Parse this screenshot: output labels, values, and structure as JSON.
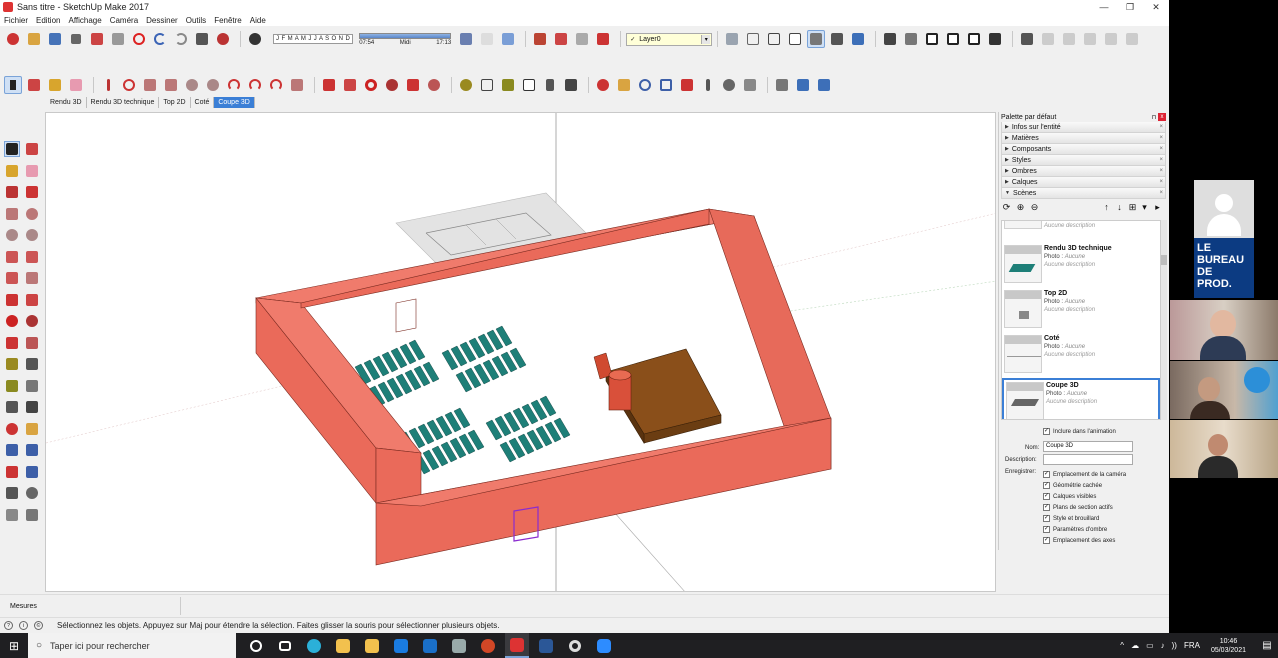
{
  "window": {
    "title": "Sans titre - SketchUp Make 2017",
    "controls": {
      "minimize": "—",
      "maximize": "❐",
      "close": "✕"
    }
  },
  "menu": [
    "Fichier",
    "Edition",
    "Affichage",
    "Caméra",
    "Dessiner",
    "Outils",
    "Fenêtre",
    "Aide"
  ],
  "shadows": {
    "months": "J F M A M J J A S O N D",
    "time_start": "07:54",
    "time_mid": "Midi",
    "time_end": "17:13"
  },
  "layer": {
    "current": "Layer0",
    "arrow": "▾",
    "check": "✓"
  },
  "scene_tabs": [
    {
      "label": "Rendu 3D",
      "active": false
    },
    {
      "label": "Rendu 3D technique",
      "active": false
    },
    {
      "label": "Top 2D",
      "active": false
    },
    {
      "label": "Coté",
      "active": false
    },
    {
      "label": "Coupe 3D",
      "active": true
    }
  ],
  "tray": {
    "title": "Palette par défaut",
    "pin": "⊓",
    "close": "x",
    "panels": [
      {
        "label": "Infos sur l'entité",
        "open": false
      },
      {
        "label": "Matières",
        "open": false
      },
      {
        "label": "Composants",
        "open": false
      },
      {
        "label": "Styles",
        "open": false
      },
      {
        "label": "Ombres",
        "open": false
      },
      {
        "label": "Calques",
        "open": false
      },
      {
        "label": "Scènes",
        "open": true
      }
    ],
    "tri_closed": "▶",
    "tri_open": "▼",
    "panel_x": "×"
  },
  "scenes": {
    "tools": [
      "⟳",
      "⊕",
      "⊖"
    ],
    "view_tools": [
      "↑",
      "↓",
      "⊞",
      "▾",
      "▸"
    ],
    "list": [
      {
        "name": "",
        "photo_label": "",
        "photo_value": "",
        "desc": "Aucune description",
        "selected": false
      },
      {
        "name": "Rendu 3D technique",
        "photo_label": "Photo : ",
        "photo_value": "Aucune",
        "desc": "Aucune description",
        "selected": false
      },
      {
        "name": "Top 2D",
        "photo_label": "Photo : ",
        "photo_value": "Aucune",
        "desc": "Aucune description",
        "selected": false
      },
      {
        "name": "Coté",
        "photo_label": "Photo : ",
        "photo_value": "Aucune",
        "desc": "Aucune description",
        "selected": false
      },
      {
        "name": "Coupe 3D",
        "photo_label": "Photo : ",
        "photo_value": "Aucune",
        "desc": "Aucune description",
        "selected": true
      }
    ],
    "include_animation": "Inclure dans l'animation",
    "name_label": "Nom:",
    "name_value": "Coupe 3D",
    "desc_label": "Description:",
    "save_label": "Enregistrer:",
    "save_options": [
      "Emplacement de la caméra",
      "Géométrie cachée",
      "Calques visibles",
      "Plans de section actifs",
      "Style et brouillard",
      "Paramètres d'ombre",
      "Emplacement des axes"
    ],
    "checkmark": "✓"
  },
  "measure": {
    "label": "Mesures"
  },
  "status": {
    "text": "Sélectionnez les objets. Appuyez sur Maj pour étendre la sélection. Faites glisser la souris pour sélectionner plusieurs objets.",
    "icons": [
      "?",
      "i",
      "©"
    ]
  },
  "video": {
    "brand_lines": [
      "LE",
      "BUREAU",
      "DE",
      "PROD."
    ]
  },
  "taskbar": {
    "start_glyph": "⊞",
    "search_glyph": "○",
    "search_placeholder": "Taper ici pour rechercher",
    "tray_icons": [
      "^",
      "☁",
      "▭",
      "♪",
      "))"
    ],
    "lang": "FRA",
    "time": "10:46",
    "date": "05/03/2021",
    "notif": "▤"
  },
  "colors": {
    "wall": "#ea6a5a",
    "wall_top": "#f07b6c",
    "seat": "#1e7f78",
    "stage": "#6b3d12",
    "cylinder": "#e0553f",
    "door": "#8a2bd0",
    "brand": "#0c3b82"
  }
}
